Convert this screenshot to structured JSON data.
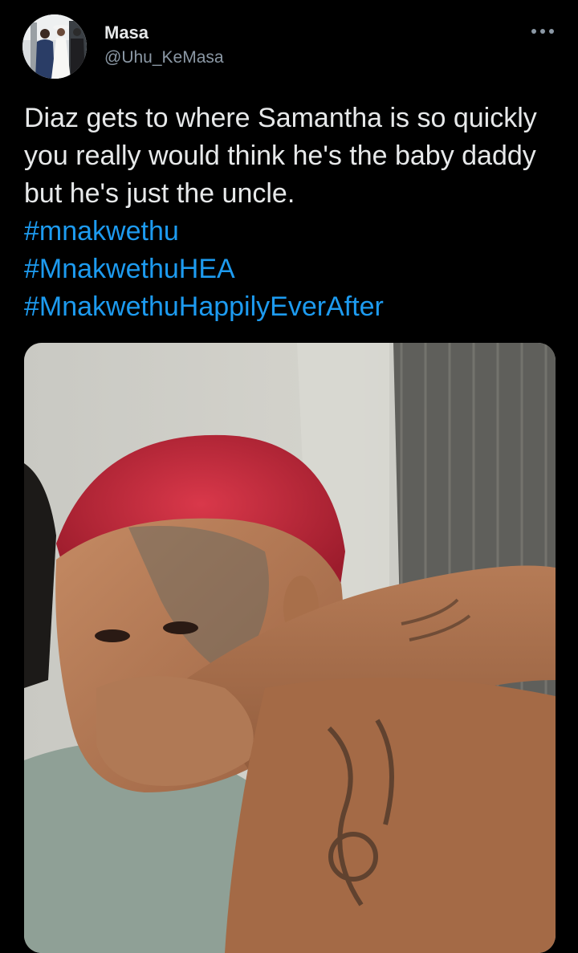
{
  "tweet": {
    "author": {
      "name": "Masa",
      "handle": "@Uhu_KeMasa"
    },
    "more_icon": "ellipsis-icon",
    "text": "Diaz gets to where Samantha is so quickly you really would think he's the baby daddy but he's just the uncle.",
    "hashtags": [
      "#mnakwethu",
      "#MnakwethuHEA",
      "#MnakwethuHappilyEverAfter"
    ],
    "media": {
      "kind": "photo"
    }
  },
  "colors": {
    "background": "#000000",
    "text": "#e7e9ea",
    "secondary_text": "#8b98a5",
    "hashtag": "#1d9bf0"
  }
}
